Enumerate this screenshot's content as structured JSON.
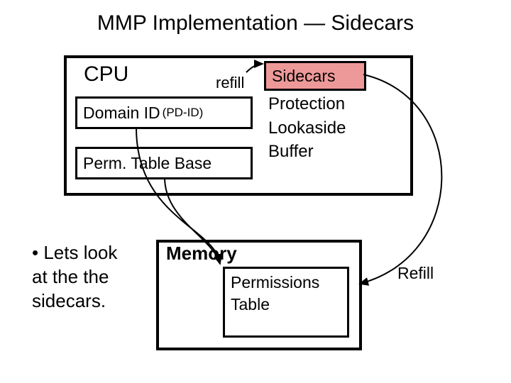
{
  "title": "MMP Implementation — Sidecars",
  "cpu": {
    "label": "CPU",
    "refill_label": "refill",
    "domain_id_main": "Domain ID",
    "domain_id_sub": "(PD-ID)",
    "perm_table_base": "Perm. Table Base",
    "sidecars_box": "Sidecars",
    "plb_line1": "Protection",
    "plb_line2": "Lookaside",
    "plb_line3": "Buffer"
  },
  "memory": {
    "label": "Memory",
    "perm_table_line1": "Permissions",
    "perm_table_line2": "Table"
  },
  "bullet": {
    "line1": "• Lets look",
    "line2": "  at the the",
    "line3": "  sidecars."
  },
  "refill_right": "Refill"
}
